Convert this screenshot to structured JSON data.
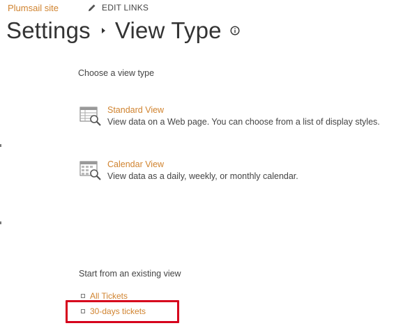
{
  "header": {
    "site_name": "Plumsail site",
    "edit_links_label": "EDIT LINKS"
  },
  "title": {
    "parent": "Settings",
    "current": "View Type"
  },
  "choose_section": {
    "heading": "Choose a view type",
    "options": [
      {
        "title": "Standard View",
        "description": "View data on a Web page. You can choose from a list of display styles."
      },
      {
        "title": "Calendar View",
        "description": "View data as a daily, weekly, or monthly calendar."
      }
    ]
  },
  "existing_section": {
    "heading": "Start from an existing view",
    "views": [
      {
        "label": "All Tickets"
      },
      {
        "label": "30-days tickets"
      }
    ]
  },
  "colors": {
    "link_orange": "#d0832f",
    "highlight_red": "#d6001c",
    "text": "#444444"
  }
}
